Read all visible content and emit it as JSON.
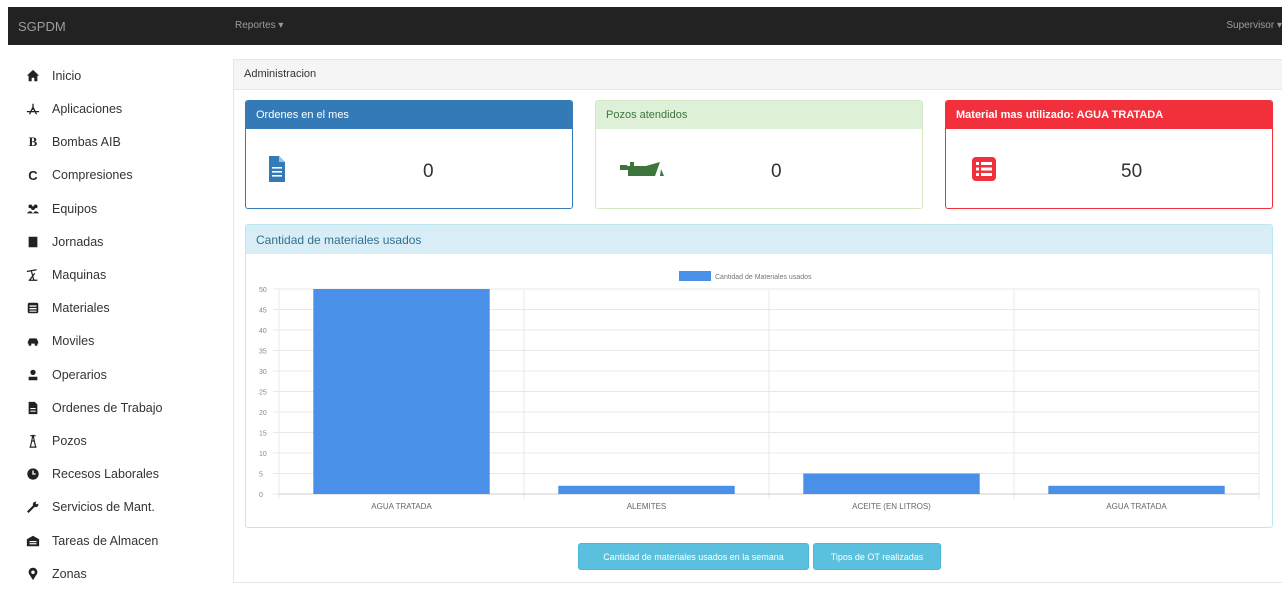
{
  "navbar": {
    "brand": "SGPDM",
    "reports_menu": "Reportes ▾",
    "user_menu": "Supervisor ▾"
  },
  "sidebar": {
    "items": [
      {
        "label": "Inicio",
        "icon": "home-icon"
      },
      {
        "label": "Aplicaciones",
        "icon": "drill-icon"
      },
      {
        "label": "Bombas AIB",
        "icon": "b-letter-icon"
      },
      {
        "label": "Compresiones",
        "icon": "c-letter-icon"
      },
      {
        "label": "Equipos",
        "icon": "users-icon"
      },
      {
        "label": "Jornadas",
        "icon": "book-icon"
      },
      {
        "label": "Maquinas",
        "icon": "pumpjack-icon"
      },
      {
        "label": "Materiales",
        "icon": "list-icon"
      },
      {
        "label": "Moviles",
        "icon": "car-icon"
      },
      {
        "label": "Operarios",
        "icon": "user-icon"
      },
      {
        "label": "Ordenes de Trabajo",
        "icon": "file-icon"
      },
      {
        "label": "Pozos",
        "icon": "tower-icon"
      },
      {
        "label": "Recesos Laborales",
        "icon": "clock-icon"
      },
      {
        "label": "Servicios de Mant.",
        "icon": "wrench-icon"
      },
      {
        "label": "Tareas de Almacen",
        "icon": "warehouse-icon"
      },
      {
        "label": "Zonas",
        "icon": "map-marker-icon"
      }
    ]
  },
  "breadcrumb": "Administracion",
  "panels": {
    "orders": {
      "title": "Ordenes en el mes",
      "value": "0",
      "icon": "document-icon",
      "color": "#337ab7"
    },
    "wells": {
      "title": "Pozos atendidos",
      "value": "0",
      "icon": "oil-can-icon",
      "color": "#dff0d8"
    },
    "material": {
      "title": "Material mas utilizado: AGUA TRATADA",
      "value": "50",
      "icon": "list-icon",
      "color": "#f2303c"
    }
  },
  "chart_panel": {
    "title": "Cantidad de materiales usados"
  },
  "chart_data": {
    "type": "bar",
    "categories": [
      "AGUA TRATADA",
      "ALEMITES",
      "ACEITE (EN LITROS)",
      "AGUA TRATADA"
    ],
    "series": [
      {
        "name": "Cantidad de Materiales usados",
        "values": [
          50,
          2,
          5,
          2
        ],
        "color": "#4a8fe8"
      }
    ],
    "ylim": [
      0,
      50
    ],
    "yticks": [
      "0",
      "5",
      "10",
      "15",
      "20",
      "25",
      "30",
      "35",
      "40",
      "45",
      "50"
    ],
    "grid": true,
    "legend": "top"
  },
  "buttons": {
    "weekly": "Cantidad de materiales usados en la semana",
    "ot_types": "Tipos de OT realizadas"
  }
}
